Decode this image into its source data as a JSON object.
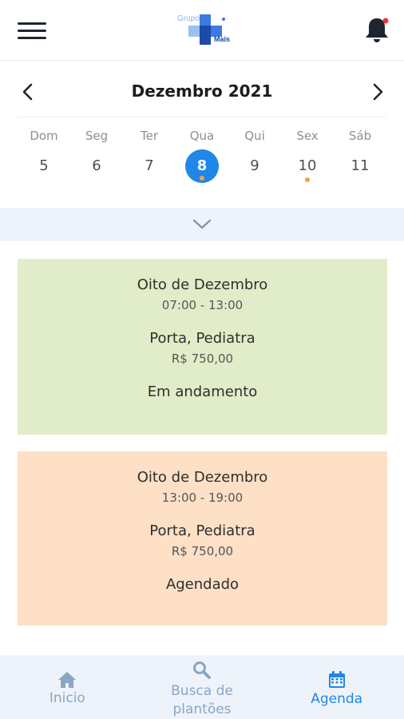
{
  "header": {
    "menu_icon": "hamburger-menu-icon",
    "logo_top": "Grupo",
    "logo_bottom": "Mais",
    "bell_icon": "bell-icon"
  },
  "calendar": {
    "month_label": "Dezembro 2021",
    "days": [
      {
        "name": "Dom",
        "date": "5"
      },
      {
        "name": "Seg",
        "date": "6"
      },
      {
        "name": "Ter",
        "date": "7"
      },
      {
        "name": "Qua",
        "date": "8"
      },
      {
        "name": "Qui",
        "date": "9"
      },
      {
        "name": "Sex",
        "date": "10"
      },
      {
        "name": "Sáb",
        "date": "11"
      }
    ]
  },
  "shifts": [
    {
      "title": "Oito de Dezembro",
      "time": "07:00 - 13:00",
      "place": "Porta, Pediatra",
      "price": "R$ 750,00",
      "status": "Em andamento",
      "color": "#e1edc8"
    },
    {
      "title": "Oito de Dezembro",
      "time": "13:00 - 19:00",
      "place": "Porta, Pediatra",
      "price": "R$ 750,00",
      "status": "Agendado",
      "color": "#fde0c6"
    }
  ],
  "nav": {
    "home_label": "Inicio",
    "search_label_1": "Busca de",
    "search_label_2": "plantões",
    "agenda_label": "Agenda"
  },
  "colors": {
    "accent": "#1f87e8",
    "dot": "#f5a13a",
    "notification": "#e53935",
    "nav_bg": "#eef3fb"
  }
}
